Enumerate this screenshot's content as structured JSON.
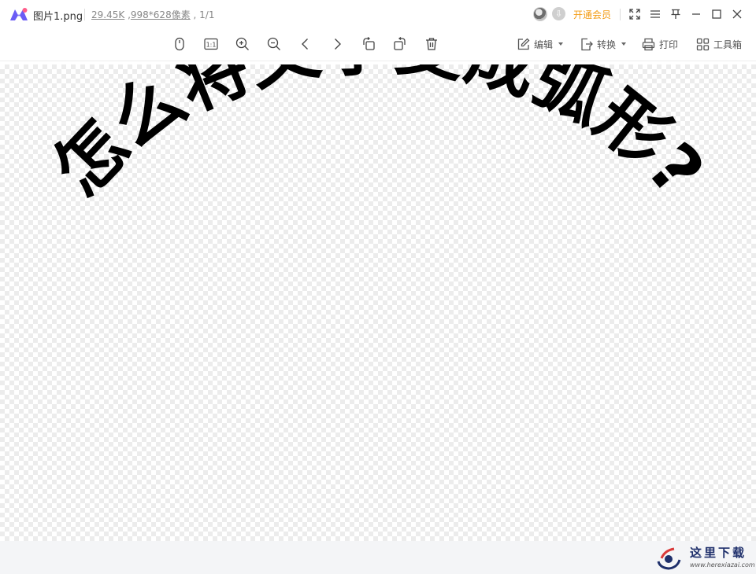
{
  "titlebar": {
    "file_name": "图片1.png",
    "file_size": "29.45K",
    "dimensions": "998*628像素",
    "page_index": "1/1",
    "vip_label": "开通会员"
  },
  "toolbar": {
    "edit_label": "编辑",
    "convert_label": "转换",
    "print_label": "打印",
    "toolbox_label": "工具箱",
    "actual_size_glyph": "1:1"
  },
  "image": {
    "arc_text": "怎么将文字变成弧形?"
  },
  "watermark": {
    "title": "这里下载",
    "url": "www.herexiazai.com"
  },
  "colors": {
    "accent": "#f39b12",
    "watermark": "#1e2f6b"
  }
}
